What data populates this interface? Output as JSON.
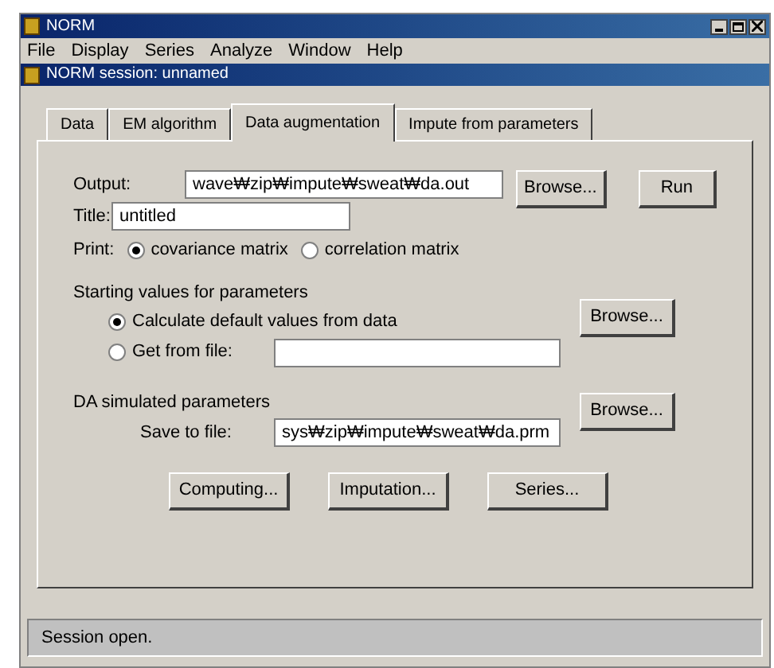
{
  "window": {
    "title": "NORM"
  },
  "menu": [
    "File",
    "Display",
    "Series",
    "Analyze",
    "Window",
    "Help"
  ],
  "session": {
    "title": "NORM session: unnamed"
  },
  "tabs": [
    {
      "label": "Data",
      "selected": false
    },
    {
      "label": "EM algorithm",
      "selected": false
    },
    {
      "label": "Data augmentation",
      "selected": true
    },
    {
      "label": "Impute from parameters",
      "selected": false
    }
  ],
  "output": {
    "label": "Output:",
    "value": "wave₩zip₩impute₩sweat₩da.out",
    "browse": "Browse...",
    "run": "Run"
  },
  "title_field": {
    "label": "Title:",
    "value": "untitled"
  },
  "print": {
    "label": "Print:",
    "options": [
      {
        "label": "covariance matrix",
        "selected": true
      },
      {
        "label": "correlation matrix",
        "selected": false
      }
    ]
  },
  "starting": {
    "heading": "Starting values for parameters",
    "options": [
      {
        "label": "Calculate default values from data",
        "selected": true
      },
      {
        "label": "Get from file:",
        "selected": false
      }
    ],
    "browse": "Browse..."
  },
  "simulated": {
    "heading": "DA simulated parameters",
    "save_label": "Save to file:",
    "value": "sys₩zip₩impute₩sweat₩da.prm",
    "browse": "Browse..."
  },
  "buttons": [
    "Computing...",
    "Imputation...",
    "Series..."
  ],
  "status_bar": "Session open."
}
